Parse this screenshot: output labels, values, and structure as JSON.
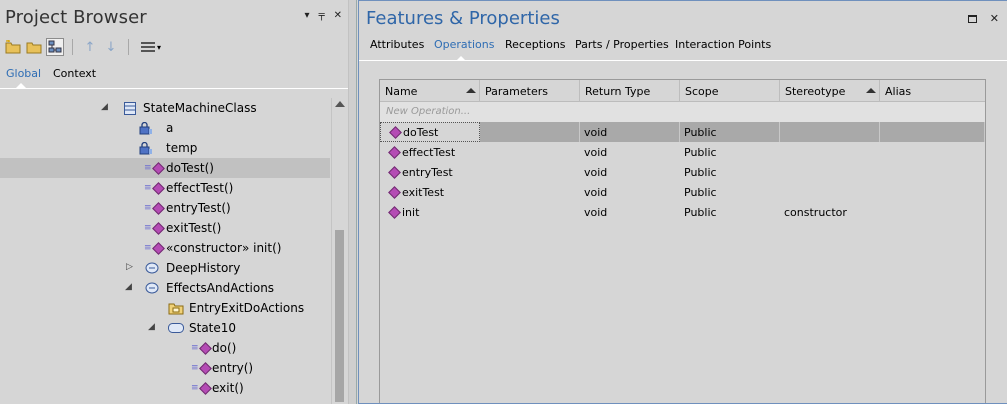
{
  "project_browser": {
    "title": "Project Browser",
    "title_controls": [
      "▾",
      "╤",
      "✕"
    ],
    "tabs": {
      "global": "Global",
      "context": "Context"
    },
    "tree": [
      {
        "label": "StateMachineClass",
        "icon": "class-icon",
        "expander": "◢"
      },
      {
        "label": "a",
        "icon": "attribute-lock-icon"
      },
      {
        "label": "temp",
        "icon": "attribute-lock-icon"
      },
      {
        "label": "doTest()",
        "icon": "operation-icon"
      },
      {
        "label": "effectTest()",
        "icon": "operation-icon"
      },
      {
        "label": "entryTest()",
        "icon": "operation-icon"
      },
      {
        "label": "exitTest()",
        "icon": "operation-icon"
      },
      {
        "label": "«constructor» init()",
        "icon": "operation-icon"
      },
      {
        "label": "DeepHistory",
        "icon": "history-state-icon",
        "expander": "▷"
      },
      {
        "label": "EffectsAndActions",
        "icon": "history-state-icon",
        "expander": "◢"
      },
      {
        "label": "EntryExitDoActions",
        "icon": "package-icon"
      },
      {
        "label": "State10",
        "icon": "state-icon",
        "expander": "◢"
      },
      {
        "label": "do()",
        "icon": "operation-icon"
      },
      {
        "label": "entry()",
        "icon": "operation-icon"
      },
      {
        "label": "exit()",
        "icon": "operation-icon"
      }
    ]
  },
  "features": {
    "title": "Features & Properties",
    "tabs": [
      "Attributes",
      "Operations",
      "Receptions",
      "Parts / Properties",
      "Interaction Points"
    ],
    "active_tab": "Operations",
    "columns": [
      "Name",
      "Parameters",
      "Return Type",
      "Scope",
      "Stereotype",
      "Alias"
    ],
    "new_row_placeholder": "New Operation...",
    "rows": [
      {
        "name": "doTest",
        "params": "",
        "rtype": "void",
        "scope": "Public",
        "stereo": "",
        "alias": ""
      },
      {
        "name": "effectTest",
        "params": "",
        "rtype": "void",
        "scope": "Public",
        "stereo": "",
        "alias": ""
      },
      {
        "name": "entryTest",
        "params": "",
        "rtype": "void",
        "scope": "Public",
        "stereo": "",
        "alias": ""
      },
      {
        "name": "exitTest",
        "params": "",
        "rtype": "void",
        "scope": "Public",
        "stereo": "",
        "alias": ""
      },
      {
        "name": "init",
        "params": "",
        "rtype": "void",
        "scope": "Public",
        "stereo": "constructor",
        "alias": ""
      }
    ]
  }
}
